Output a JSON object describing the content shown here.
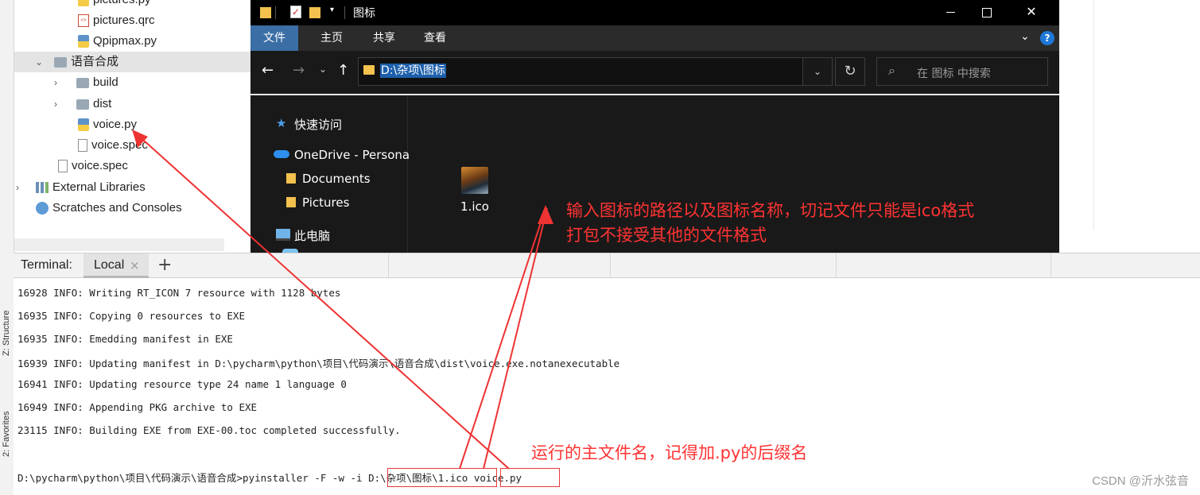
{
  "ide": {
    "side_tabs": [
      "Z: Structure",
      "2: Favorites"
    ],
    "tree": [
      {
        "label": "pictures.py",
        "type": "py"
      },
      {
        "label": "pictures.qrc",
        "type": "qrc"
      },
      {
        "label": "Qpipmax.py",
        "type": "py"
      },
      {
        "label": "语音合成",
        "type": "folder-open"
      },
      {
        "label": "build",
        "type": "folder"
      },
      {
        "label": "dist",
        "type": "folder"
      },
      {
        "label": "voice.py",
        "type": "py"
      },
      {
        "label": "voice.spec",
        "type": "spec"
      },
      {
        "label": "voice.spec",
        "type": "spec"
      },
      {
        "label": "External Libraries",
        "type": "lib"
      },
      {
        "label": "Scratches and Consoles",
        "type": "scratch"
      }
    ]
  },
  "explorer": {
    "title": "图标",
    "ribbon_tabs": [
      "文件",
      "主页",
      "共享",
      "查看"
    ],
    "address": "D:\\杂项\\图标",
    "search_placeholder": "在 图标 中搜索",
    "nav_items": [
      "快速访问",
      "OneDrive - Persona",
      "Documents",
      "Pictures",
      "此电脑"
    ],
    "files": [
      {
        "name": "1.ico"
      }
    ],
    "window_buttons": {
      "minimize": "—",
      "maximize": "☐",
      "close": "✕"
    }
  },
  "terminal": {
    "label": "Terminal:",
    "tab": "Local",
    "close_glyph": "×",
    "add_glyph": "+",
    "lines": [
      "16928 INFO: Writing RT_ICON 7 resource with 1128 bytes",
      "16935 INFO: Copying 0 resources to EXE",
      "16935 INFO: Emedding manifest in EXE",
      "16939 INFO: Updating manifest in D:\\pycharm\\python\\项目\\代码演示\\语音合成\\dist\\voice.exe.notanexecutable",
      "16941 INFO: Updating resource type 24 name 1 language 0",
      "16949 INFO: Appending PKG archive to EXE",
      "23115 INFO: Building EXE from EXE-00.toc completed successfully."
    ],
    "prompt": "D:\\pycharm\\python\\项目\\代码演示\\语音合成>pyinstaller -F -w -i ",
    "icon_arg": "D:\\杂项\\图标\\1.ico",
    "file_arg": "voice.py"
  },
  "annotations": {
    "icon_note_line1": "输入图标的路径以及图标名称，切记文件只能是ico格式",
    "icon_note_line2": "打包不接受其他的文件格式",
    "main_note": "运行的主文件名，记得加.py的后缀名",
    "color": "#ff3333"
  },
  "watermark": "CSDN @沂水弦音"
}
